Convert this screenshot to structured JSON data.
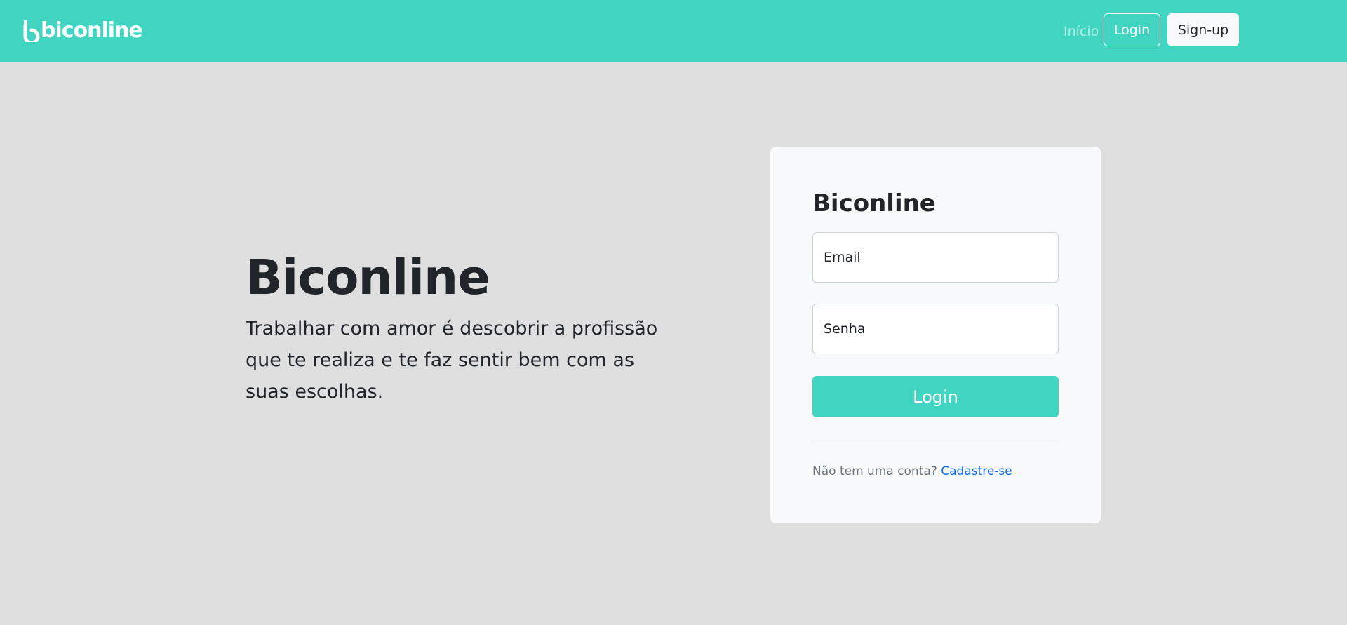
{
  "navbar": {
    "brand": "biconline",
    "links": {
      "inicio": "Início",
      "login": "Login",
      "signup": "Sign-up"
    },
    "colors": {
      "background": "#41d4c1"
    }
  },
  "hero": {
    "title": "Biconline",
    "text": "Trabalhar com amor é descobrir a profissão que te realiza e te faz sentir bem com as suas escolhas."
  },
  "login_card": {
    "title": "Biconline",
    "email_placeholder": "Email",
    "password_placeholder": "Senha",
    "submit_label": "Login",
    "no_account_text": "Não tem uma conta?",
    "signup_link": "Cadastre-se"
  },
  "colors": {
    "accent": "#41d4c1",
    "page_background": "#dfdfdf",
    "card_background": "#f8f9fa",
    "link": "#0d6efd"
  },
  "icons": {
    "brand_mark": "biconline-logo-icon"
  }
}
